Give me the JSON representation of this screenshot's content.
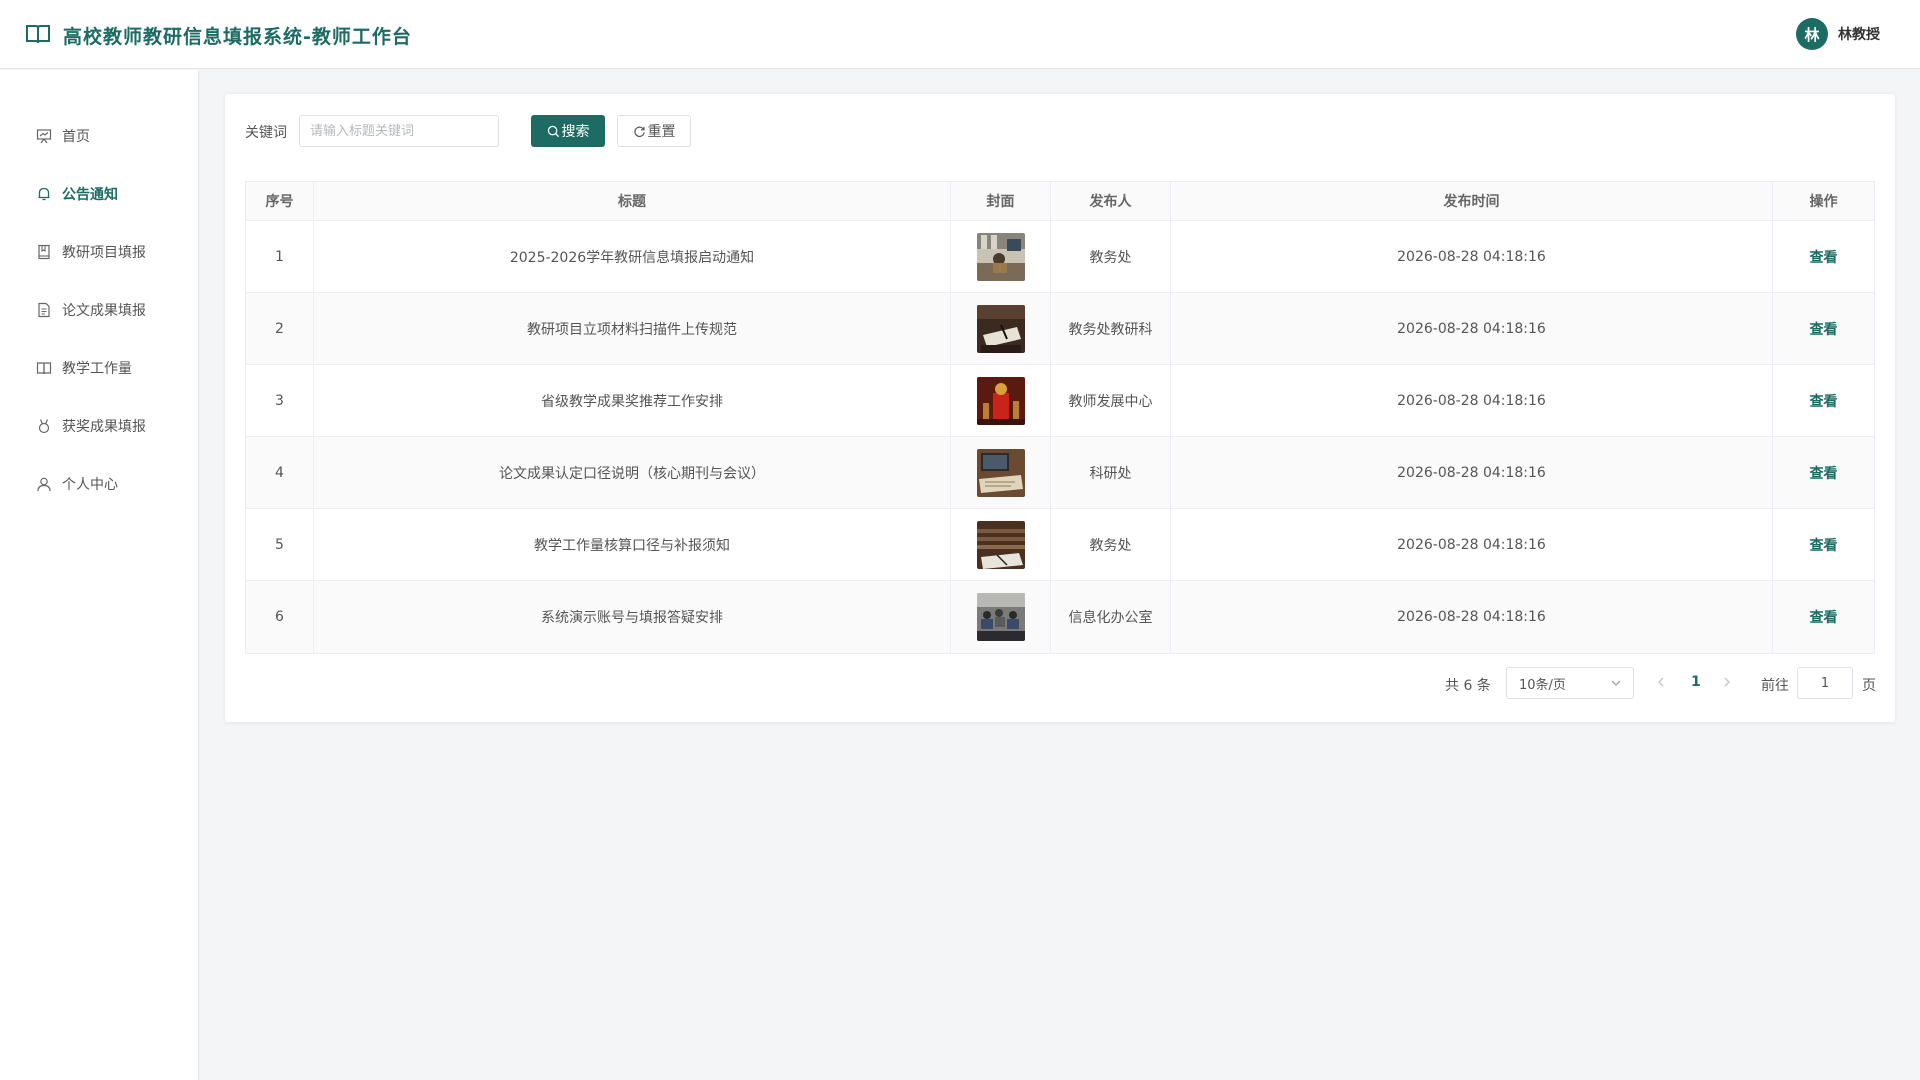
{
  "header": {
    "title": "高校教师教研信息填报系统-教师工作台",
    "user_initial": "林",
    "user_name": "林教授"
  },
  "colors": {
    "brand": "#1d6b63"
  },
  "sidebar": {
    "items": [
      {
        "label": "首页",
        "icon": "presentation-icon",
        "active": false
      },
      {
        "label": "公告通知",
        "icon": "bell-icon",
        "active": true
      },
      {
        "label": "教研项目填报",
        "icon": "bookmark-book-icon",
        "active": false
      },
      {
        "label": "论文成果填报",
        "icon": "document-icon",
        "active": false
      },
      {
        "label": "教学工作量",
        "icon": "open-book-icon",
        "active": false
      },
      {
        "label": "获奖成果填报",
        "icon": "medal-icon",
        "active": false
      },
      {
        "label": "个人中心",
        "icon": "user-icon",
        "active": false
      }
    ]
  },
  "search": {
    "label": "关键词",
    "placeholder": "请输入标题关键词",
    "value": "",
    "search_label": "搜索",
    "reset_label": "重置"
  },
  "table": {
    "columns": [
      "序号",
      "标题",
      "封面",
      "发布人",
      "发布时间",
      "操作"
    ],
    "rows": [
      {
        "index": "1",
        "title": "2025-2026学年教研信息填报启动通知",
        "cover": "office-photo",
        "publisher": "教务处",
        "time": "2026-08-28 04:18:16",
        "action": "查看"
      },
      {
        "index": "2",
        "title": "教研项目立项材料扫描件上传规范",
        "cover": "desk-documents-photo",
        "publisher": "教务处教研科",
        "time": "2026-08-28 04:18:16",
        "action": "查看"
      },
      {
        "index": "3",
        "title": "省级教学成果奖推荐工作安排",
        "cover": "trophy-photo",
        "publisher": "教师发展中心",
        "time": "2026-08-28 04:18:16",
        "action": "查看"
      },
      {
        "index": "4",
        "title": "论文成果认定口径说明（核心期刊与会议）",
        "cover": "papers-photo",
        "publisher": "科研处",
        "time": "2026-08-28 04:18:16",
        "action": "查看"
      },
      {
        "index": "5",
        "title": "教学工作量核算口径与补报须知",
        "cover": "classroom-photo",
        "publisher": "教务处",
        "time": "2026-08-28 04:18:16",
        "action": "查看"
      },
      {
        "index": "6",
        "title": "系统演示账号与填报答疑安排",
        "cover": "meeting-photo",
        "publisher": "信息化办公室",
        "time": "2026-08-28 04:18:16",
        "action": "查看"
      }
    ]
  },
  "pagination": {
    "total": "共 6 条",
    "page_size": "10条/页",
    "current_page": "1",
    "goto_label": "前往",
    "goto_value": "1",
    "page_unit": "页"
  }
}
